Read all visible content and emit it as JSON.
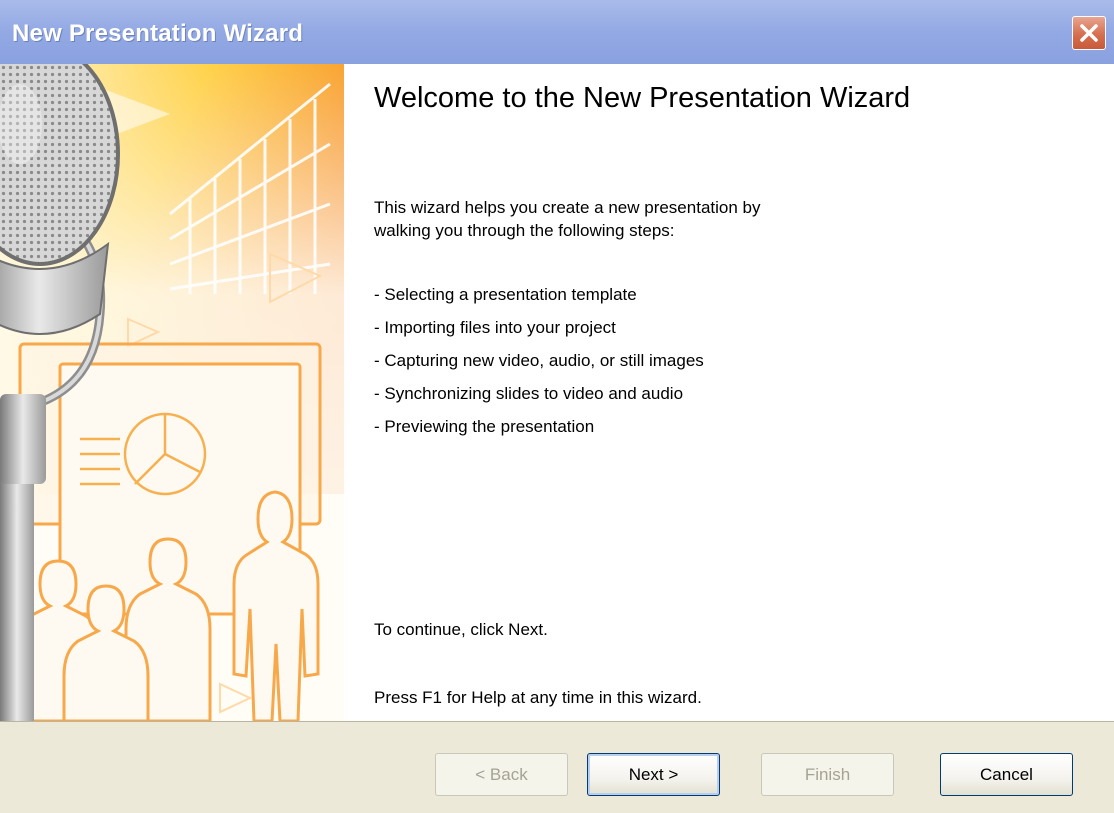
{
  "window": {
    "title": "New Presentation Wizard"
  },
  "content": {
    "heading": "Welcome to the New Presentation Wizard",
    "intro_line1": "This wizard helps you create a new presentation by",
    "intro_line2": "walking you through the following steps:",
    "steps": [
      "- Selecting a presentation template",
      "- Importing files into your project",
      "- Capturing new video, audio, or still images",
      "- Synchronizing slides to video and audio",
      "- Previewing the presentation"
    ],
    "continue_text": "To continue, click Next.",
    "help_text": "Press F1 for Help at any time in this wizard."
  },
  "buttons": {
    "back": "< Back",
    "next": "Next >",
    "finish": "Finish",
    "cancel": "Cancel"
  },
  "colors": {
    "titlebar": "#93a9e4",
    "close_button": "#d56f4f",
    "footer": "#ece9d8",
    "accent_orange": "#f6a21d"
  }
}
